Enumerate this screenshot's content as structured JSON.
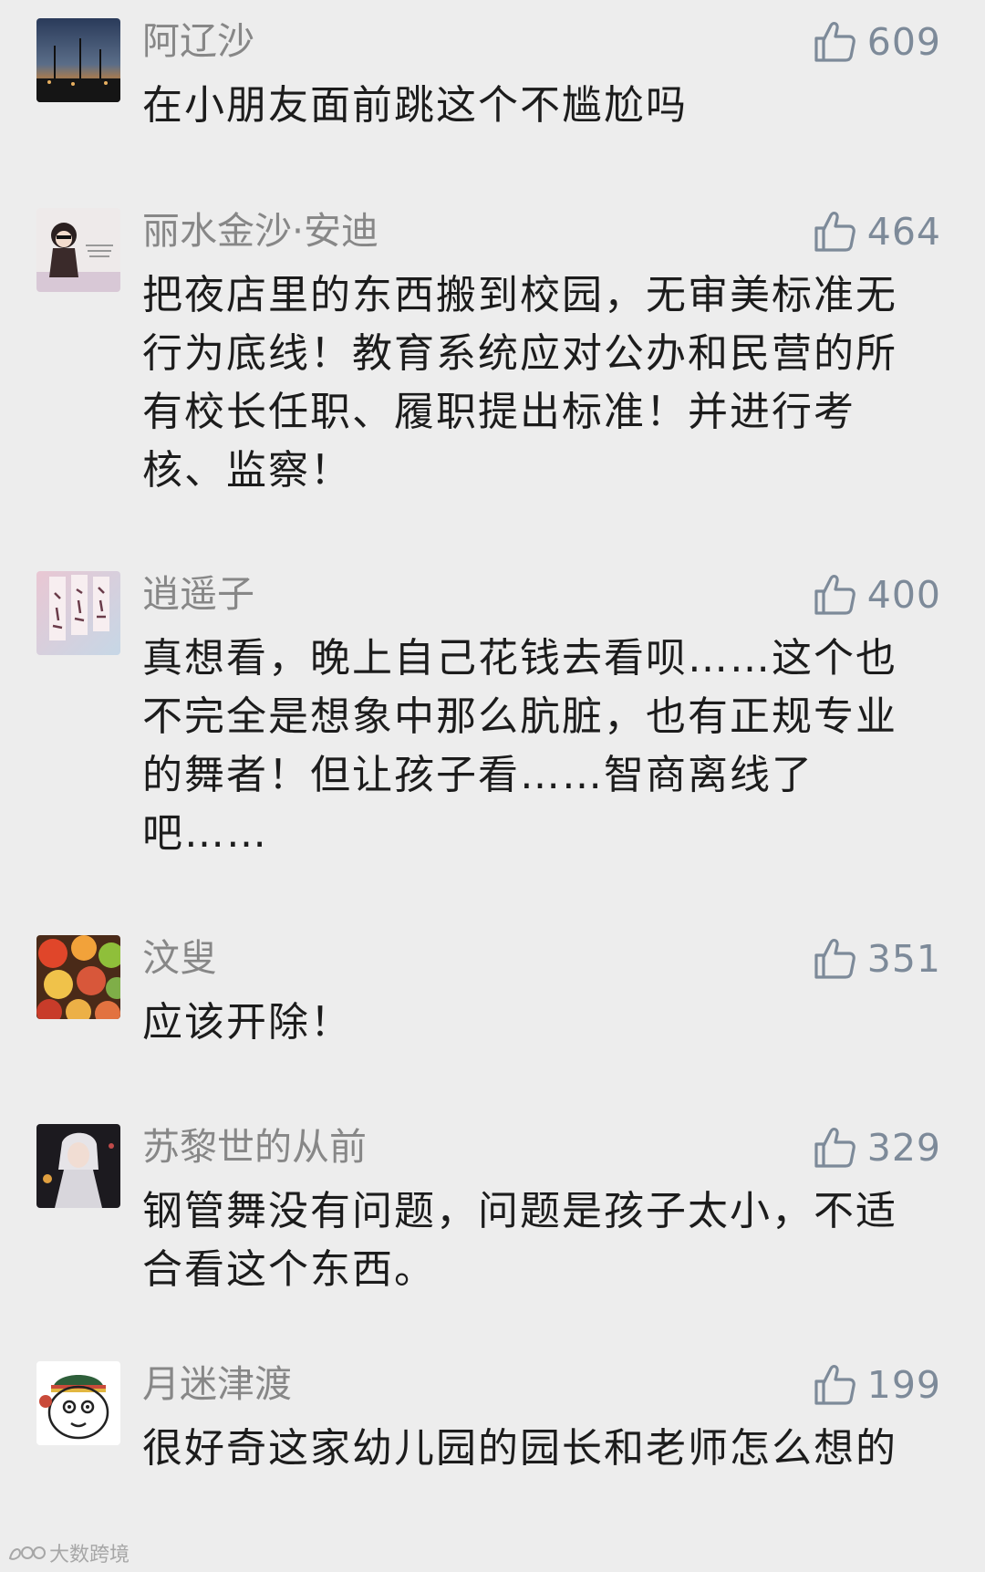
{
  "comments": [
    {
      "nickname": "阿辽沙",
      "likes": "609",
      "text": "在小朋友面前跳这个不尴尬吗",
      "avatar": "night-harbor-photo"
    },
    {
      "nickname": "丽水金沙·安迪",
      "likes": "464",
      "text": "把夜店里的东西搬到校园，无审美标准无行为底线！教育系统应对公办和民营的所有校长任职、履职提出标准！并进行考核、监察！",
      "avatar": "girl-with-sunglasses-illustration"
    },
    {
      "nickname": "逍遥子",
      "likes": "400",
      "text": "真想看，晚上自己花钱去看呗……这个也不完全是想象中那么肮脏，也有正规专业的舞者！但让孩子看……智商离线了吧……",
      "avatar": "pink-calligraphy-tags"
    },
    {
      "nickname": "汶叟",
      "likes": "351",
      "text": "应该开除！",
      "avatar": "colorful-fruit-photo"
    },
    {
      "nickname": "苏黎世的从前",
      "likes": "329",
      "text": "钢管舞没有问题，问题是孩子太小，不适合看这个东西。",
      "avatar": "anime-white-hair-character"
    },
    {
      "nickname": "月迷津渡",
      "likes": "199",
      "text": "很好奇这家幼儿园的园长和老师怎么想的",
      "avatar": "cartoon-face-with-beanie"
    }
  ],
  "watermark": {
    "text": "大数跨境"
  },
  "colors": {
    "background": "#ededed",
    "nickname": "#878787",
    "like_count": "#7d8a99",
    "comment_text": "#1c1c1c"
  }
}
